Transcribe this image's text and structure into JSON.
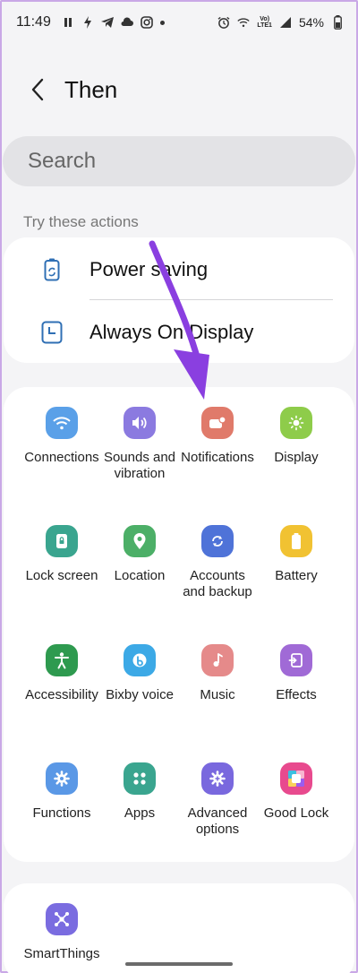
{
  "status_bar": {
    "time": "11:49",
    "battery": "54%",
    "network": "VoLTE1"
  },
  "header": {
    "title": "Then",
    "back_icon": "back-chevron-icon"
  },
  "search": {
    "placeholder": "Search"
  },
  "actions": {
    "section_label": "Try these actions",
    "items": [
      {
        "label": "Power saving",
        "icon": "battery-recycle-icon",
        "color": "#2f6fb4"
      },
      {
        "label": "Always On Display",
        "icon": "clock-icon",
        "color": "#2f6fb4"
      }
    ]
  },
  "grid": {
    "items": [
      {
        "label": "Connections",
        "icon": "wifi-icon",
        "color": "#5aa0e8"
      },
      {
        "label": "Sounds and vibration",
        "icon": "volume-icon",
        "color": "#8b7ae0"
      },
      {
        "label": "Notifications",
        "icon": "notification-icon",
        "color": "#e07a6a"
      },
      {
        "label": "Display",
        "icon": "brightness-icon",
        "color": "#8ecc4a"
      },
      {
        "label": "Lock screen",
        "icon": "lock-icon",
        "color": "#3aa58f"
      },
      {
        "label": "Location",
        "icon": "location-pin-icon",
        "color": "#4caf67"
      },
      {
        "label": "Accounts and backup",
        "icon": "sync-icon",
        "color": "#4f73d8"
      },
      {
        "label": "Battery",
        "icon": "battery-icon",
        "color": "#f1c232"
      },
      {
        "label": "Accessibility",
        "icon": "accessibility-icon",
        "color": "#2e9a4f"
      },
      {
        "label": "Bixby voice",
        "icon": "bixby-icon",
        "color": "#3ca9e6"
      },
      {
        "label": "Music",
        "icon": "music-note-icon",
        "color": "#e58a8a"
      },
      {
        "label": "Effects",
        "icon": "effects-icon",
        "color": "#a06ad6"
      },
      {
        "label": "Functions",
        "icon": "gear-icon",
        "color": "#5a98e6"
      },
      {
        "label": "Apps",
        "icon": "apps-grid-icon",
        "color": "#3aa58f"
      },
      {
        "label": "Advanced options",
        "icon": "gear-icon",
        "color": "#7968de"
      },
      {
        "label": "Good Lock",
        "icon": "good-lock-icon",
        "color": "#e84a8e"
      },
      {
        "label": "SmartThings",
        "icon": "smartthings-icon",
        "color": "#7a6ce0"
      }
    ]
  },
  "annotation": {
    "arrow_color": "#8a3fe0"
  }
}
